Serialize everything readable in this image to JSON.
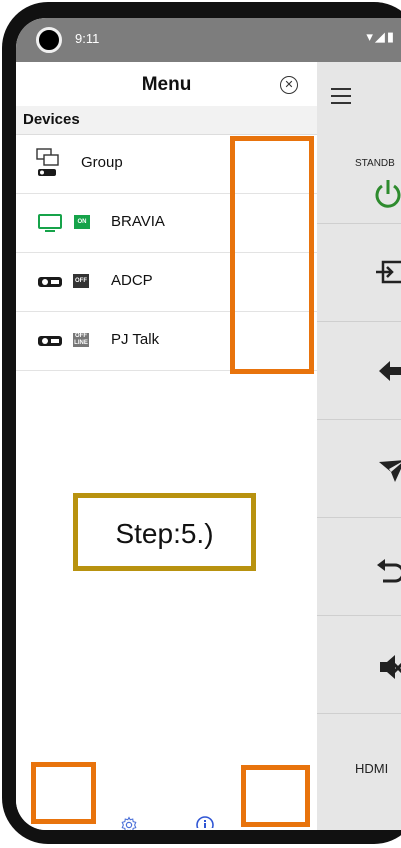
{
  "status_bar": {
    "time": "9:11",
    "icons": "▾◢▮"
  },
  "menu": {
    "title": "Menu",
    "section": "Devices",
    "devices": [
      {
        "label": "Group",
        "badge": ""
      },
      {
        "label": "BRAVIA",
        "badge": "ON"
      },
      {
        "label": "ADCP",
        "badge": "OFF"
      },
      {
        "label": "PJ Talk",
        "badge": "OFF LINE"
      }
    ]
  },
  "remote": {
    "standby_label": "STANDB",
    "hdmi_label": "HDMI"
  },
  "annotation": {
    "step_text": "Step:5.)"
  },
  "colors": {
    "orange": "#e8730c",
    "gold": "#b8920f",
    "green": "#16a34a",
    "remote_bg": "#e6e6e6",
    "status_bg": "#7d7d7d"
  }
}
